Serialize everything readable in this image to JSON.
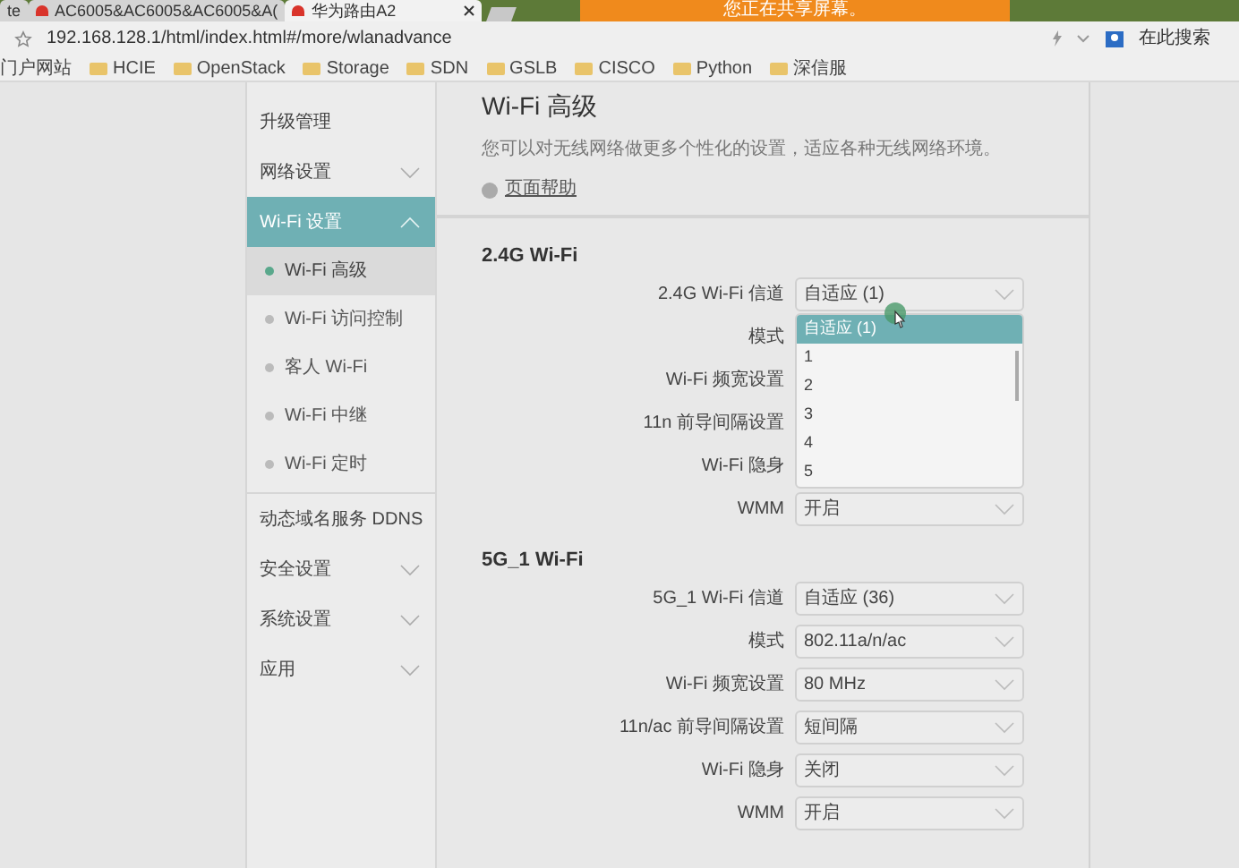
{
  "browser": {
    "tabs": [
      {
        "label": "te",
        "selected": false,
        "closable": false
      },
      {
        "label": "AC6005&AC6005&AC6005&A(",
        "selected": false,
        "closable": false
      },
      {
        "label": "华为路由A2",
        "selected": true,
        "closable": true
      }
    ],
    "banner": "您正在共享屏幕。",
    "address": "192.168.128.1/html/index.html#/more/wlanadvance",
    "search_placeholder": "在此搜索",
    "bookmarks": [
      {
        "label": "门户网站",
        "folder": false
      },
      {
        "label": "HCIE",
        "folder": true
      },
      {
        "label": "OpenStack",
        "folder": true
      },
      {
        "label": "Storage",
        "folder": true
      },
      {
        "label": "SDN",
        "folder": true
      },
      {
        "label": "GSLB",
        "folder": true
      },
      {
        "label": "CISCO",
        "folder": true
      },
      {
        "label": "Python",
        "folder": true
      },
      {
        "label": "深信服",
        "folder": true
      }
    ]
  },
  "sidebar": {
    "items": [
      {
        "label": "升级管理",
        "kind": "link",
        "selected": false
      },
      {
        "label": "网络设置",
        "kind": "group",
        "expanded": false,
        "selected": false
      },
      {
        "label": "Wi-Fi 设置",
        "kind": "group",
        "expanded": true,
        "selected": true,
        "children": [
          {
            "label": "Wi-Fi 高级",
            "selected": true
          },
          {
            "label": "Wi-Fi 访问控制",
            "selected": false
          },
          {
            "label": "客人 Wi-Fi",
            "selected": false
          },
          {
            "label": "Wi-Fi 中继",
            "selected": false
          },
          {
            "label": "Wi-Fi 定时",
            "selected": false
          }
        ]
      },
      {
        "label": "动态域名服务 DDNS",
        "kind": "link",
        "selected": false
      },
      {
        "label": "安全设置",
        "kind": "group",
        "expanded": false,
        "selected": false
      },
      {
        "label": "系统设置",
        "kind": "group",
        "expanded": false,
        "selected": false
      },
      {
        "label": "应用",
        "kind": "group",
        "expanded": false,
        "selected": false
      }
    ]
  },
  "page": {
    "title": "Wi-Fi 高级",
    "description": "您可以对无线网络做更多个性化的设置，适应各种无线网络环境。",
    "help_link": "页面帮助",
    "sections": [
      {
        "heading": "2.4G Wi-Fi",
        "rows": [
          {
            "label": "2.4G Wi-Fi 信道",
            "value": "自适应 (1)",
            "open": true,
            "options": [
              {
                "label": "自适应 (1)",
                "selected": true
              },
              {
                "label": "1",
                "selected": false
              },
              {
                "label": "2",
                "selected": false
              },
              {
                "label": "3",
                "selected": false
              },
              {
                "label": "4",
                "selected": false
              },
              {
                "label": "5",
                "selected": false
              }
            ]
          },
          {
            "label": "模式"
          },
          {
            "label": "Wi-Fi 频宽设置"
          },
          {
            "label": "11n 前导间隔设置"
          },
          {
            "label": "Wi-Fi 隐身"
          },
          {
            "label": "WMM",
            "value": "开启"
          }
        ]
      },
      {
        "heading": "5G_1 Wi-Fi",
        "rows": [
          {
            "label": "5G_1 Wi-Fi 信道",
            "value": "自适应 (36)"
          },
          {
            "label": "模式",
            "value": "802.11a/n/ac"
          },
          {
            "label": "Wi-Fi 频宽设置",
            "value": "80 MHz"
          },
          {
            "label": "11n/ac 前导间隔设置",
            "value": "短间隔"
          },
          {
            "label": "Wi-Fi 隐身",
            "value": "关闭"
          },
          {
            "label": "WMM",
            "value": "开启"
          }
        ]
      }
    ]
  }
}
